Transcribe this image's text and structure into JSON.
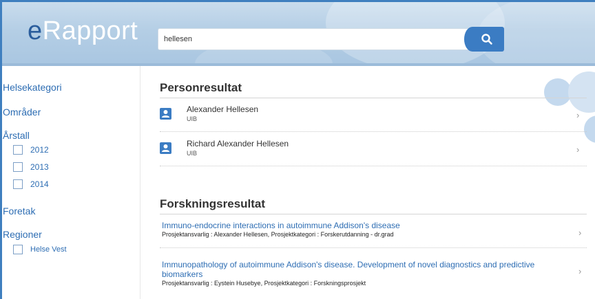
{
  "header": {
    "logo_e": "e",
    "logo_rest": "Rapport",
    "search_value": "hellesen",
    "search_button_icon": "search-icon"
  },
  "sidebar": {
    "helsekategori": "Helsekategori",
    "omrader": "Områder",
    "arstall": "Årstall",
    "years": [
      "2012",
      "2013",
      "2014"
    ],
    "foretak": "Foretak",
    "regioner": "Regioner",
    "region_option": "Helse Vest"
  },
  "persons": {
    "title": "Personresultat",
    "items": [
      {
        "name": "Alexander Hellesen",
        "org": "UIB"
      },
      {
        "name": "Richard Alexander Hellesen",
        "org": "UIB"
      }
    ]
  },
  "research": {
    "title": "Forskningsresultat",
    "items": [
      {
        "title": "Immuno-endocrine interactions in autoimmune Addison's disease",
        "meta": "Prosjektansvarlig : Alexander Hellesen, Prosjektkategori : Forskerutdanning - dr.grad"
      },
      {
        "title": "Immunopathology of autoimmune Addison's disease. Development of novel diagnostics and predictive biomarkers",
        "meta": "Prosjektansvarlig : Eystein Husebye, Prosjektkategori : Forskningsprosjekt"
      }
    ]
  },
  "colors": {
    "accent": "#3b7cc3",
    "link": "#2d6db3",
    "header_bg": "#b4cee5"
  }
}
